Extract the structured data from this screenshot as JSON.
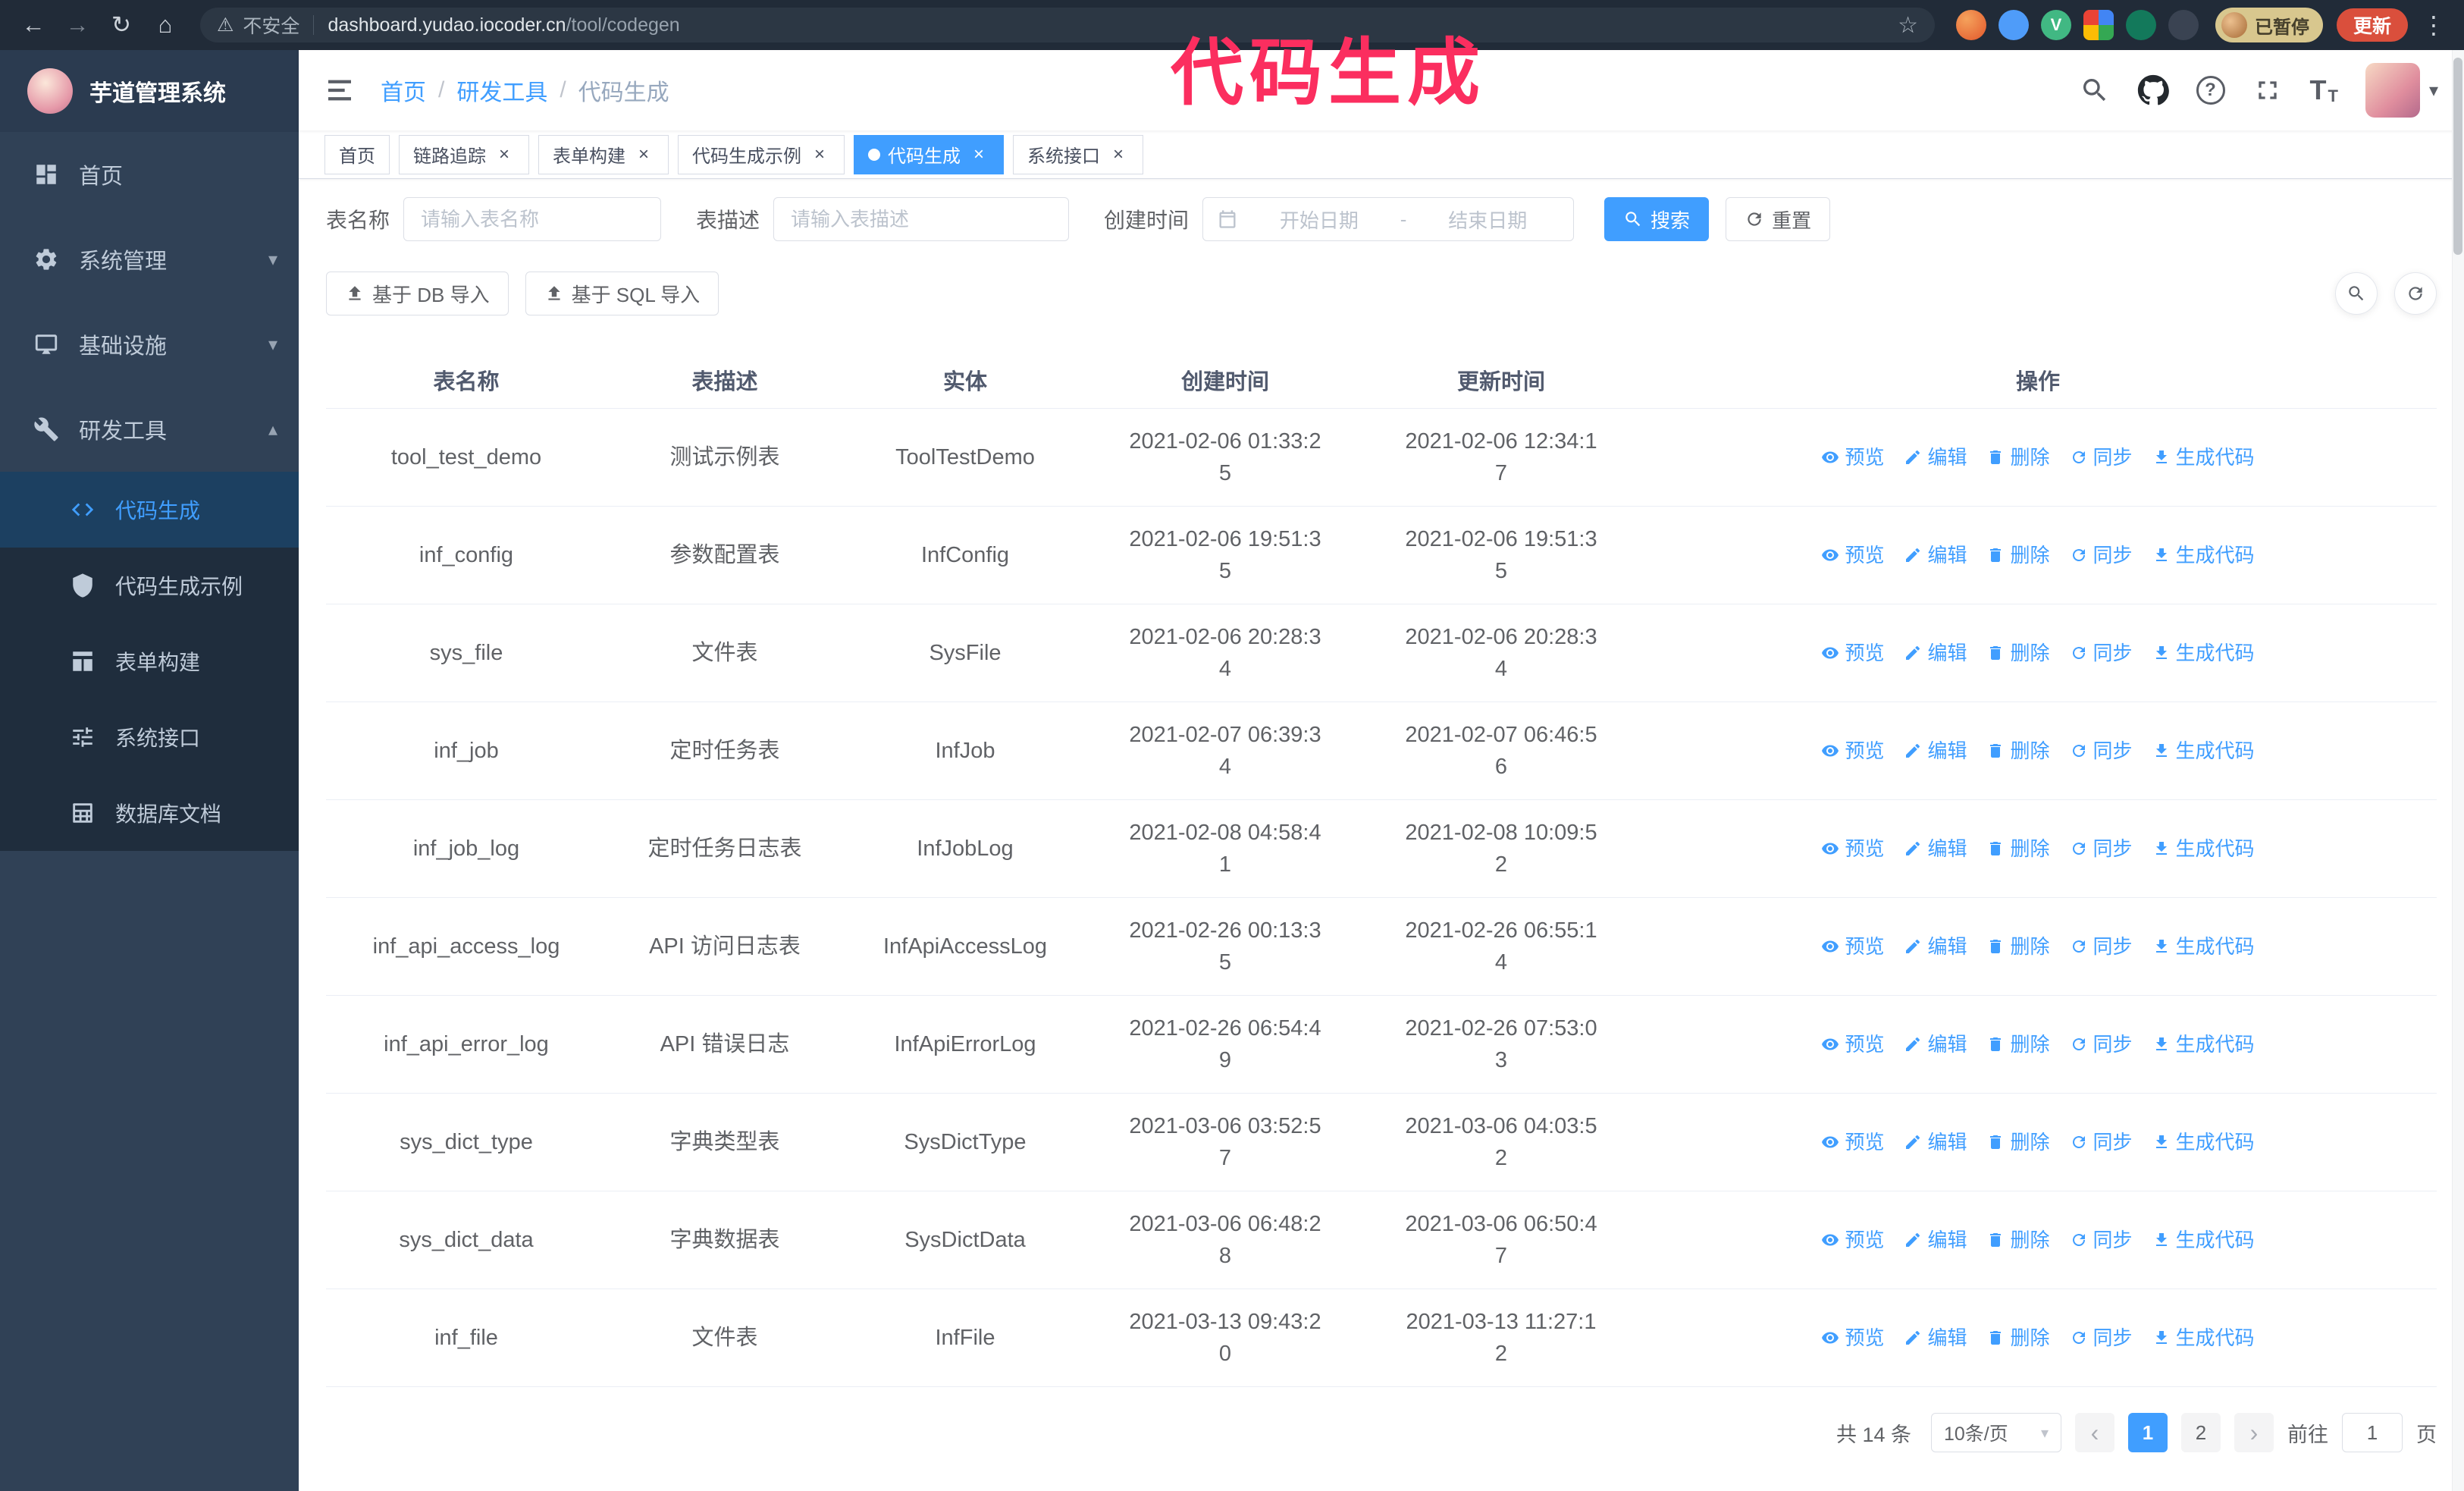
{
  "theme": {
    "accent": "#409EFF",
    "sidebar_bg": "#304156",
    "submenu_bg": "#1f2d3d"
  },
  "annotation": {
    "text": "代码生成",
    "color": "#fb2e5f"
  },
  "browser": {
    "security_warning": "不安全",
    "url_domain": "dashboard.yudao.iocoder.cn",
    "url_path": "/tool/codegen",
    "paused_badge": "已暂停",
    "update_button": "更新",
    "vue_ext_letter": "V"
  },
  "icons": {
    "back": "←",
    "forward": "→",
    "reload": "↻",
    "home": "⌂",
    "warning": "⚠",
    "star": "☆",
    "kebab": "⋮",
    "close": "×",
    "caret_down": "▾",
    "chevron_down": "▾",
    "chevron_up": "▴",
    "prev": "‹",
    "next": "›",
    "breadcrumb_sep": "/",
    "help": "?",
    "fontsize_large": "T",
    "fontsize_small": "T"
  },
  "sidebar": {
    "logo_title": "芋道管理系统",
    "items": [
      {
        "label": "首页"
      },
      {
        "label": "系统管理"
      },
      {
        "label": "基础设施"
      },
      {
        "label": "研发工具"
      }
    ],
    "submenu": [
      {
        "label": "代码生成"
      },
      {
        "label": "代码生成示例"
      },
      {
        "label": "表单构建"
      },
      {
        "label": "系统接口"
      },
      {
        "label": "数据库文档"
      }
    ]
  },
  "breadcrumb": [
    "首页",
    "研发工具",
    "代码生成"
  ],
  "tabs": [
    {
      "label": "首页"
    },
    {
      "label": "链路追踪"
    },
    {
      "label": "表单构建"
    },
    {
      "label": "代码生成示例"
    },
    {
      "label": "代码生成"
    },
    {
      "label": "系统接口"
    }
  ],
  "filters": {
    "table_name_label": "表名称",
    "table_name_placeholder": "请输入表名称",
    "table_desc_label": "表描述",
    "table_desc_placeholder": "请输入表描述",
    "create_time_label": "创建时间",
    "date_start_placeholder": "开始日期",
    "date_separator": "-",
    "date_end_placeholder": "结束日期",
    "search_button": "搜索",
    "reset_button": "重置"
  },
  "toolbar": {
    "import_db_button": "基于 DB 导入",
    "import_sql_button": "基于 SQL 导入"
  },
  "table": {
    "columns": [
      "表名称",
      "表描述",
      "实体",
      "创建时间",
      "更新时间",
      "操作"
    ],
    "actions": [
      "预览",
      "编辑",
      "删除",
      "同步",
      "生成代码"
    ],
    "rows": [
      {
        "name": "tool_test_demo",
        "desc": "测试示例表",
        "entity": "ToolTestDemo",
        "created": "2021-02-06 01:33:25",
        "updated": "2021-02-06 12:34:17"
      },
      {
        "name": "inf_config",
        "desc": "参数配置表",
        "entity": "InfConfig",
        "created": "2021-02-06 19:51:35",
        "updated": "2021-02-06 19:51:35"
      },
      {
        "name": "sys_file",
        "desc": "文件表",
        "entity": "SysFile",
        "created": "2021-02-06 20:28:34",
        "updated": "2021-02-06 20:28:34"
      },
      {
        "name": "inf_job",
        "desc": "定时任务表",
        "entity": "InfJob",
        "created": "2021-02-07 06:39:34",
        "updated": "2021-02-07 06:46:56"
      },
      {
        "name": "inf_job_log",
        "desc": "定时任务日志表",
        "entity": "InfJobLog",
        "created": "2021-02-08 04:58:41",
        "updated": "2021-02-08 10:09:52"
      },
      {
        "name": "inf_api_access_log",
        "desc": "API 访问日志表",
        "entity": "InfApiAccessLog",
        "created": "2021-02-26 00:13:35",
        "updated": "2021-02-26 06:55:14"
      },
      {
        "name": "inf_api_error_log",
        "desc": "API 错误日志",
        "entity": "InfApiErrorLog",
        "created": "2021-02-26 06:54:49",
        "updated": "2021-02-26 07:53:03"
      },
      {
        "name": "sys_dict_type",
        "desc": "字典类型表",
        "entity": "SysDictType",
        "created": "2021-03-06 03:52:57",
        "updated": "2021-03-06 04:03:52"
      },
      {
        "name": "sys_dict_data",
        "desc": "字典数据表",
        "entity": "SysDictData",
        "created": "2021-03-06 06:48:28",
        "updated": "2021-03-06 06:50:47"
      },
      {
        "name": "inf_file",
        "desc": "文件表",
        "entity": "InfFile",
        "created": "2021-03-13 09:43:20",
        "updated": "2021-03-13 11:27:12"
      }
    ]
  },
  "pagination": {
    "total": "共 14 条",
    "page_size": "10条/页",
    "pages": [
      "1",
      "2"
    ],
    "goto_label": "前往",
    "goto_value": "1",
    "goto_suffix": "页"
  }
}
